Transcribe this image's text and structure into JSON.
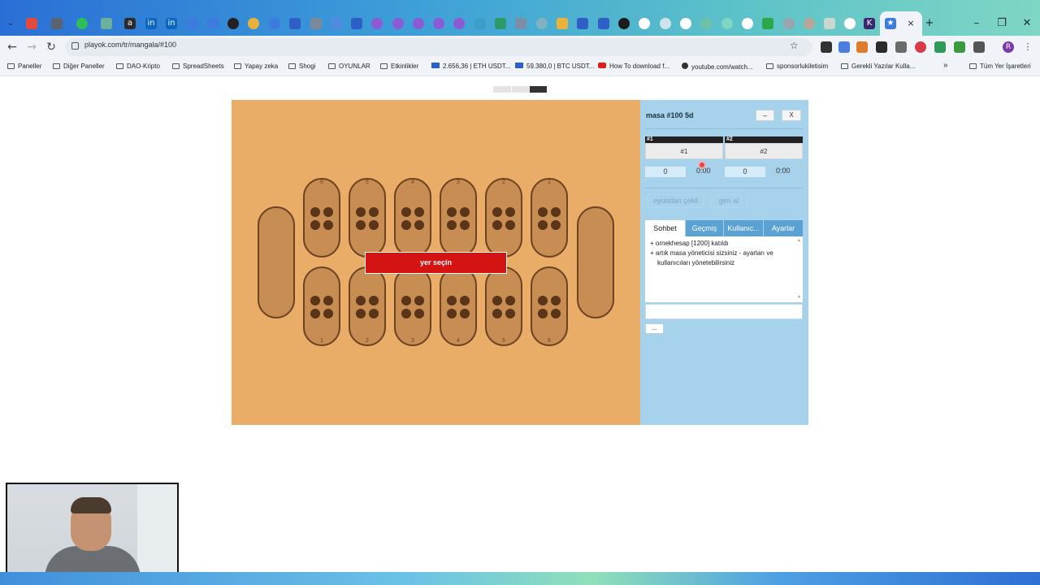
{
  "browser": {
    "url": "playok.com/tr/mangala/#100",
    "bookmarks": [
      "Paneller",
      "Diğer Paneller",
      "DAO-Kripto",
      "SpreadSheets",
      "Yapay zeka",
      "Shogi",
      "OYUNLAR",
      "Etkinlikler",
      "2.656,36 | ETH USDT...",
      "59.380,0 | BTC USDT...",
      "How To download f...",
      "youtube.com/watch...",
      "sponsorlukiletisim",
      "Gerekli Yazılar Kulla...",
      "»",
      "Tüm Yer İşaretleri"
    ]
  },
  "board": {
    "top_pit_numbers": [
      "6",
      "5",
      "4",
      "3",
      "2",
      "1"
    ],
    "bottom_pit_numbers": [
      "1",
      "2",
      "3",
      "4",
      "5",
      "6"
    ],
    "stones_per_pit": 4,
    "banner": "yer seçin"
  },
  "panel": {
    "title": "masa #100   5d",
    "minimize": "–",
    "close": "X",
    "seat1_head": "#1",
    "seat2_head": "#2",
    "seat1_button": "#1",
    "seat2_button": "#2",
    "score1": "0",
    "time1": "0:00",
    "score2": "0",
    "time2": "0:00",
    "resign": "oyundan çekil",
    "undo": "geri al",
    "tabs": [
      "Sohbet",
      "Geçmiş",
      "Kullanıc...",
      "Ayarlar"
    ],
    "chat": [
      "+ ornekhesap [1200] katıldı",
      "+ artık masa yöneticisi sizsiniz - ayarları ve kullanıcıları yönetebilirsiniz"
    ],
    "more": "..."
  },
  "colors": {
    "board": "#e9ad68",
    "pit": "#c88d53",
    "stone": "#5a3419",
    "banner": "#d41313",
    "panel": "#a7d2ec"
  }
}
